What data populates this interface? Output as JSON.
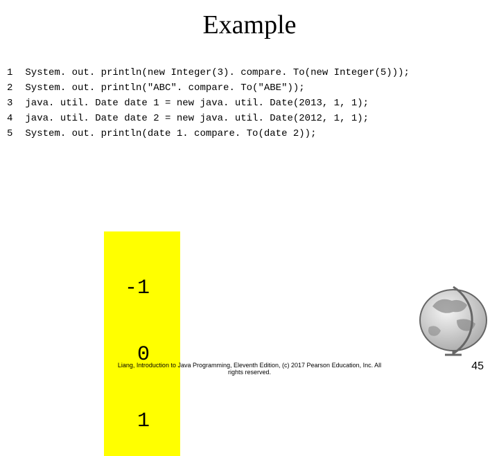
{
  "title": "Example",
  "code": {
    "line_numbers": [
      "1",
      "2",
      "3",
      "4",
      "5"
    ],
    "lines": [
      "System. out. println(new Integer(3). compare. To(new Integer(5)));",
      "System. out. println(\"ABC\". compare. To(\"ABE\"));",
      "java. util. Date date 1 = new java. util. Date(2013, 1, 1);",
      "java. util. Date date 2 = new java. util. Date(2012, 1, 1);",
      "System. out. println(date 1. compare. To(date 2));"
    ]
  },
  "output": {
    "lines": [
      "-1",
      "0",
      "1"
    ]
  },
  "footer": {
    "text_line1": "Liang, Introduction to Java Programming, Eleventh Edition, (c) 2017 Pearson Education, Inc. All",
    "text_line2": "rights reserved."
  },
  "page_number": "45"
}
